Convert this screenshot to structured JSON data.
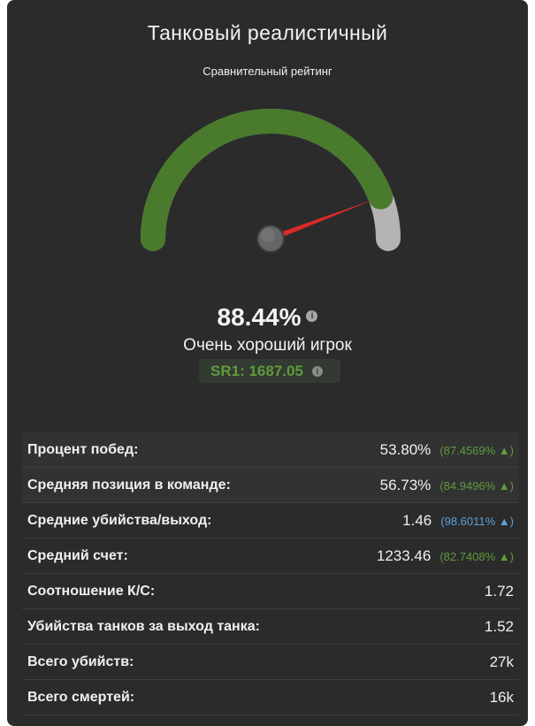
{
  "header": {
    "title": "Танковый реалистичный",
    "subtitle": "Сравнительный рейтинг"
  },
  "gauge": {
    "percent_value": 88.44,
    "fill_color": "#4a7a2c",
    "track_color": "#b4b4b4",
    "needle_color": "#e02828",
    "hub_color": "#666666"
  },
  "rating": {
    "percent": "88.44%",
    "info_icon": "i",
    "player_class": "Очень хороший игрок",
    "sr_label": "SR1: 1687.05",
    "sr_info_icon": "i"
  },
  "stats": [
    {
      "label": "Процент побед:",
      "value": "53.80%",
      "percentile": "(87.4569% ▲)",
      "color": "green"
    },
    {
      "label": "Средняя позиция в команде:",
      "value": "56.73%",
      "percentile": "(84.9496% ▲)",
      "color": "green"
    },
    {
      "label": "Средние убийства/выход:",
      "value": "1.46",
      "percentile": "(98.6011% ▲)",
      "color": "blue"
    },
    {
      "label": "Средний счет:",
      "value": "1233.46",
      "percentile": "(82.7408% ▲)",
      "color": "green"
    },
    {
      "label": "Соотношение К/С:",
      "value": "1.72"
    },
    {
      "label": "Убийства танков за выход танка:",
      "value": "1.52"
    },
    {
      "label": "Всего убийств:",
      "value": "27k"
    },
    {
      "label": "Всего смертей:",
      "value": "16k"
    }
  ]
}
